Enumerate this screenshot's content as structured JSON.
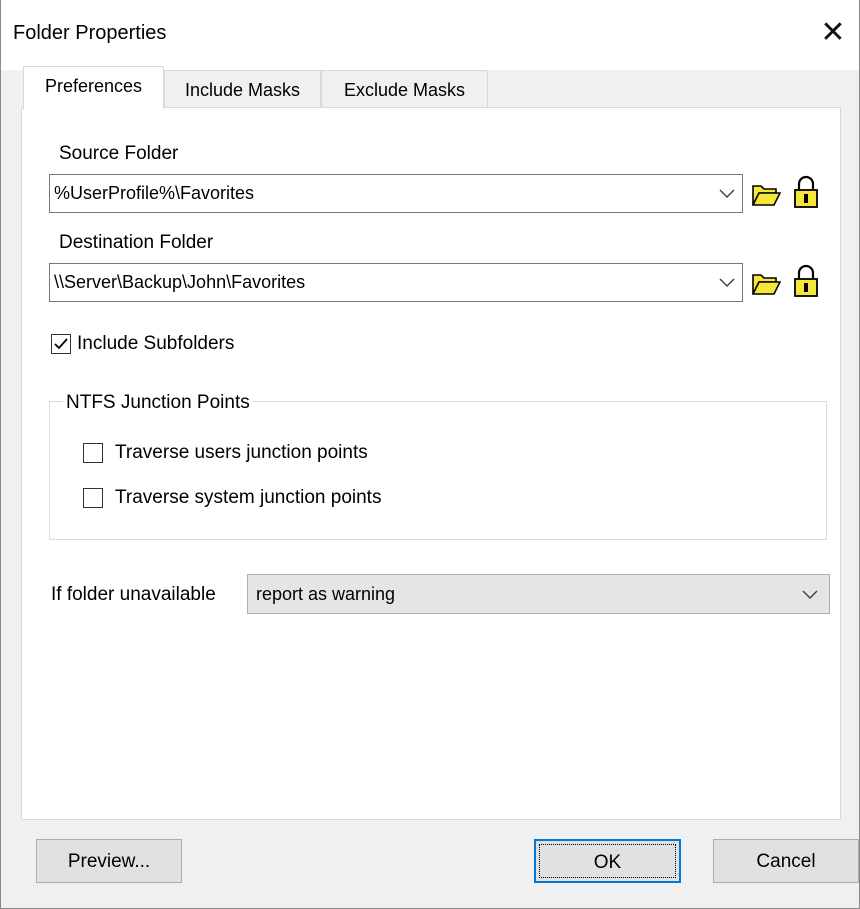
{
  "window": {
    "title": "Folder Properties",
    "close_glyph": "✕"
  },
  "tabs": [
    {
      "label": "Preferences",
      "active": true
    },
    {
      "label": "Include Masks",
      "active": false
    },
    {
      "label": "Exclude Masks",
      "active": false
    }
  ],
  "source": {
    "label": "Source Folder",
    "value": "%UserProfile%\\Favorites",
    "browse_icon": "open-folder-icon",
    "lock_icon": "lock-icon"
  },
  "destination": {
    "label": "Destination Folder",
    "value": "\\\\Server\\Backup\\John\\Favorites",
    "browse_icon": "open-folder-icon",
    "lock_icon": "lock-icon"
  },
  "include_subfolders": {
    "label": "Include Subfolders",
    "checked": true
  },
  "junction": {
    "legend": "NTFS Junction Points",
    "users": {
      "label": "Traverse users junction points",
      "checked": false
    },
    "system": {
      "label": "Traverse system junction points",
      "checked": false
    }
  },
  "unavailable": {
    "label": "If folder unavailable",
    "value": "report as warning"
  },
  "buttons": {
    "preview": "Preview...",
    "ok": "OK",
    "cancel": "Cancel"
  },
  "colors": {
    "accent": "#0078d7",
    "icon_yellow": "#f5e63a"
  }
}
